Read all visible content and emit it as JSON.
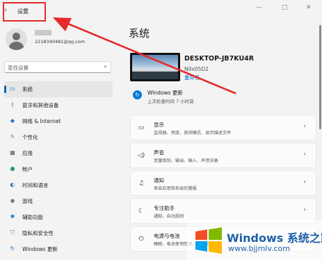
{
  "titlebar": {
    "back_glyph": "‹",
    "title": "设置",
    "minimize_glyph": "—",
    "maximize_glyph": "□",
    "close_glyph": "✕"
  },
  "account": {
    "email": "2218340481@qq.com",
    "avatar_icon": "user-avatar-icon"
  },
  "search": {
    "placeholder": "查找设置",
    "icon": "search-icon"
  },
  "sidebar": {
    "accent_color": "#0067c0",
    "items": [
      {
        "label": "系统",
        "icon": "system-icon",
        "glyph": "▭",
        "color": "#0067c0",
        "active": true
      },
      {
        "label": "蓝牙和其他设备",
        "icon": "bluetooth-icon",
        "glyph": "ᛒ",
        "color": "#0067c0"
      },
      {
        "label": "网络 & Internet",
        "icon": "wifi-icon",
        "glyph": "◆",
        "color": "#1a73c8"
      },
      {
        "label": "个性化",
        "icon": "brush-icon",
        "glyph": "✎",
        "color": "#c0652a"
      },
      {
        "label": "应用",
        "icon": "apps-icon",
        "glyph": "▦",
        "color": "#555555"
      },
      {
        "label": "帐户",
        "icon": "account-icon",
        "glyph": "●",
        "color": "#2a9a6a"
      },
      {
        "label": "时间和语言",
        "icon": "globe-icon",
        "glyph": "◐",
        "color": "#1a73c8"
      },
      {
        "label": "游戏",
        "icon": "gamepad-icon",
        "glyph": "◉",
        "color": "#666666"
      },
      {
        "label": "辅助功能",
        "icon": "accessibility-icon",
        "glyph": "✱",
        "color": "#1a73c8"
      },
      {
        "label": "隐私和安全性",
        "icon": "shield-icon",
        "glyph": "⛉",
        "color": "#666666"
      },
      {
        "label": "Windows 更新",
        "icon": "update-icon",
        "glyph": "↻",
        "color": "#1a73c8"
      }
    ]
  },
  "main": {
    "title": "系统",
    "device": {
      "name": "DESKTOP-JB7KU4R",
      "model": "N9x05D2",
      "rename": "重命名"
    },
    "update": {
      "title": "Windows 更新",
      "subtitle": "上次检查时间 7 小时前",
      "icon": "update-icon",
      "glyph": "↻"
    },
    "cards": [
      {
        "title": "显示",
        "subtitle": "监视器、亮度、夜间模式、显示描述文件",
        "icon": "display-icon",
        "glyph": "▭"
      },
      {
        "title": "声音",
        "subtitle": "音量级别、输出、输入、声音设备",
        "icon": "speaker-icon",
        "glyph": "◁)"
      },
      {
        "title": "通知",
        "subtitle": "来自应用和系统的警报",
        "icon": "bell-icon",
        "glyph": "♫"
      },
      {
        "title": "专注助手",
        "subtitle": "通知、自动规则",
        "icon": "moon-icon",
        "glyph": "☾"
      },
      {
        "title": "电源与电池",
        "subtitle": "睡眠、电池使用情况、节电模式",
        "icon": "power-icon",
        "glyph": "⏻"
      }
    ],
    "chevron": "›"
  },
  "annotation": {
    "highlight_color": "#e52a2a"
  },
  "watermark": {
    "main": "Windows 系统之家",
    "url": "www.bjjmlv.com"
  }
}
